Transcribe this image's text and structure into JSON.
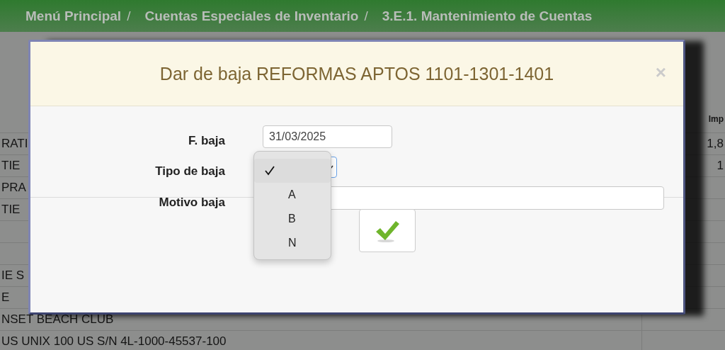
{
  "breadcrumb": {
    "separator": "/",
    "items": [
      "Menú Principal",
      "Cuentas Especiales de Inventario",
      "3.E.1. Mantenimiento de Cuentas"
    ]
  },
  "table": {
    "amount_header": "Imp",
    "rows": [
      {
        "description": "RATI",
        "amount": "1,8"
      },
      {
        "description": "TIE",
        "amount": "1"
      },
      {
        "description": "PRA"
      },
      {
        "description": "TIE"
      },
      {},
      {},
      {
        "description": "IE S"
      },
      {
        "description": "E"
      },
      {
        "description": "NSET BEACH CLUB"
      },
      {
        "description": "US UNIX 100 US S/N 4L-1000-45537-100"
      }
    ]
  },
  "dialog": {
    "title": "Dar de baja REFORMAS APTOS 1101-1301-1401",
    "close": "×",
    "fields": [
      {
        "kind": "date",
        "label": "F. baja",
        "value": "31/03/2025"
      },
      {
        "kind": "select",
        "label": "Tipo de baja",
        "focused": true
      },
      {
        "kind": "text",
        "label": "Motivo baja"
      }
    ],
    "dropdown": {
      "options": [
        {
          "selected": true
        },
        {
          "label": "A",
          "selected": false
        },
        {
          "label": "B",
          "selected": false
        },
        {
          "label": "N",
          "selected": false
        }
      ]
    }
  }
}
